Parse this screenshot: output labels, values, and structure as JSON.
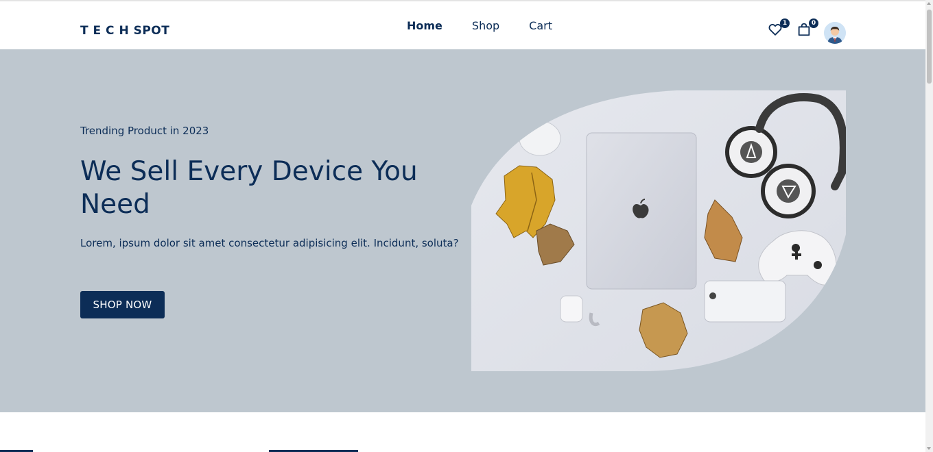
{
  "brand": {
    "logo_text": "T E C H SPOT"
  },
  "nav": {
    "items": [
      {
        "label": "Home",
        "active": true
      },
      {
        "label": "Shop",
        "active": false
      },
      {
        "label": "Cart",
        "active": false
      }
    ]
  },
  "header_icons": {
    "wishlist": {
      "icon": "heart-icon",
      "count": "1"
    },
    "cart": {
      "icon": "shopping-bag-icon",
      "count": "0"
    },
    "profile": {
      "icon": "user-avatar"
    }
  },
  "hero": {
    "eyebrow": "Trending Product in 2023",
    "headline": "We Sell Every Device You Need",
    "description": "Lorem, ipsum dolor sit amet consectetur adipisicing elit. Incidunt, soluta?",
    "cta_label": "SHOP NOW",
    "image": "hero-products-image"
  },
  "colors": {
    "primary": "#0c2d57",
    "hero_bg": "#bec7cf",
    "header_bg": "#ffffff"
  }
}
